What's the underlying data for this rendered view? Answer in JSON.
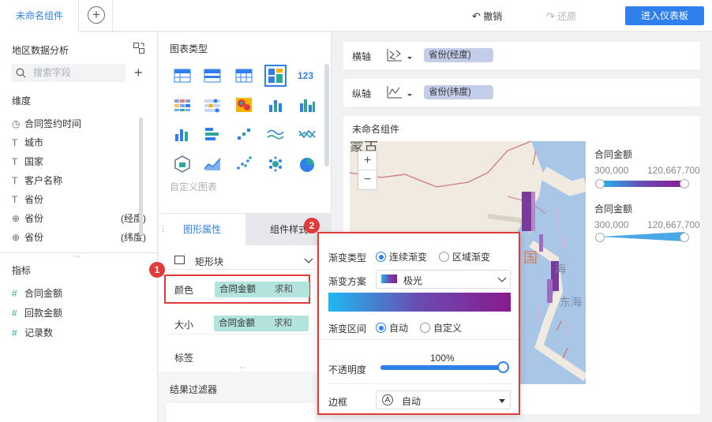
{
  "header": {
    "tab_label": "未命名组件",
    "undo_label": "撤销",
    "redo_label": "还原",
    "enter_dashboard_label": "进入仪表板"
  },
  "data_pane": {
    "dataset_name": "地区数据分析",
    "search_placeholder": "搜索字段",
    "dimensions_title": "维度",
    "dimensions": [
      {
        "icon": "clock-icon",
        "label": "合同签约时间",
        "suffix": ""
      },
      {
        "icon": "text-type-icon",
        "label": "城市",
        "suffix": ""
      },
      {
        "icon": "text-type-icon",
        "label": "国家",
        "suffix": ""
      },
      {
        "icon": "text-type-icon",
        "label": "客户名称",
        "suffix": ""
      },
      {
        "icon": "text-type-icon",
        "label": "省份",
        "suffix": ""
      },
      {
        "icon": "globe-icon",
        "label": "省份",
        "suffix": "(经度)"
      },
      {
        "icon": "globe-icon",
        "label": "省份",
        "suffix": "(纬度)"
      }
    ],
    "measures_title": "指标",
    "measures": [
      {
        "icon": "hash-icon",
        "label": "合同金额"
      },
      {
        "icon": "hash-icon",
        "label": "回款金额"
      },
      {
        "icon": "hash-calc-icon",
        "label": "记录数"
      }
    ]
  },
  "chart_pane": {
    "chart_types_title": "图表类型",
    "custom_chart_label": "自定义图表",
    "tab_graphic_attr": "图形属性",
    "tab_component_style": "组件样式",
    "shape_select": "矩形块",
    "color_label": "颜色",
    "color_field": "合同金额",
    "color_agg": "求和",
    "size_label": "大小",
    "size_field": "合同金额",
    "size_agg": "求和",
    "label_label": "标签",
    "result_filter_title": "结果过滤器",
    "colors": {
      "chart_icon_blue": "#2f80ed",
      "selected_border": "#2f80ed"
    }
  },
  "axes": {
    "x_label": "横轴",
    "x_field": "省份(经度)",
    "y_label": "纵轴",
    "y_field": "省份(纬度)"
  },
  "canvas": {
    "title": "未命名组件",
    "legend_color_title": "合同金额",
    "legend_color_min": "300,000",
    "legend_color_max": "120,667,700",
    "legend_size_title": "合同金额",
    "legend_size_min": "300,000",
    "legend_size_max": "120,667,700",
    "map_labels": [
      "国",
      "海",
      "东海"
    ],
    "map_label_partial_top": "蒙古",
    "zoom_in": "+",
    "zoom_out": "−"
  },
  "gradient_popup": {
    "type_label": "渐变类型",
    "type_option_continuous": "连续渐变",
    "type_option_region": "区域渐变",
    "type_selected": "连续渐变",
    "scheme_label": "渐变方案",
    "scheme_value": "极光",
    "range_label": "渐变区间",
    "range_option_auto": "自动",
    "range_option_custom": "自定义",
    "range_selected": "自动",
    "opacity_label": "不透明度",
    "opacity_value": "100%",
    "opacity_level": 1.0,
    "border_label": "边框",
    "border_value": "自动",
    "gradient_colors": [
      "#1fb8f2",
      "#6a4bb0",
      "#8a1a8f"
    ]
  },
  "annotations": {
    "badge_1": "1",
    "badge_2": "2",
    "highlight_color": "#e03a3a"
  }
}
